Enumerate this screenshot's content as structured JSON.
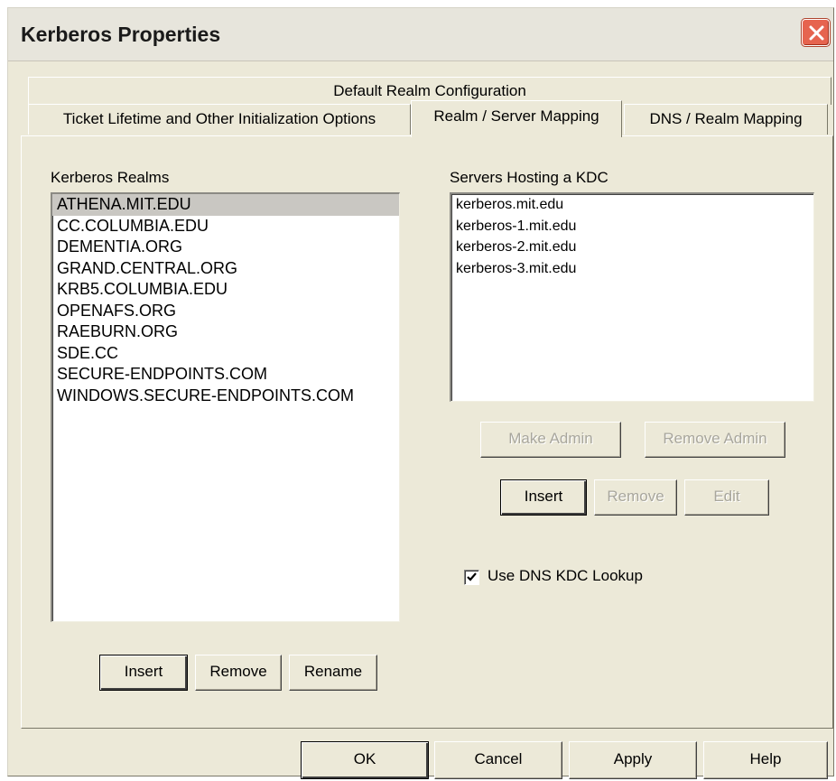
{
  "window": {
    "title": "Kerberos Properties",
    "close_icon": "close-icon"
  },
  "tabs": {
    "back_row": [
      {
        "label": "Default Realm Configuration"
      }
    ],
    "front_row": [
      {
        "label": "Ticket Lifetime and Other Initialization Options",
        "active": false
      },
      {
        "label": "Realm / Server Mapping",
        "active": true
      },
      {
        "label": "DNS / Realm Mapping",
        "active": false
      }
    ]
  },
  "realms": {
    "label": "Kerberos Realms",
    "selected": "ATHENA.MIT.EDU",
    "items": [
      "ATHENA.MIT.EDU",
      "CC.COLUMBIA.EDU",
      "DEMENTIA.ORG",
      "GRAND.CENTRAL.ORG",
      "KRB5.COLUMBIA.EDU",
      "OPENAFS.ORG",
      "RAEBURN.ORG",
      "SDE.CC",
      "SECURE-ENDPOINTS.COM",
      "WINDOWS.SECURE-ENDPOINTS.COM"
    ],
    "buttons": {
      "insert": "Insert",
      "remove": "Remove",
      "rename": "Rename"
    }
  },
  "kdc": {
    "label": "Servers Hosting a KDC",
    "items": [
      "kerberos.mit.edu",
      "kerberos-1.mit.edu",
      "kerberos-2.mit.edu",
      "kerberos-3.mit.edu"
    ],
    "buttons": {
      "make_admin": "Make Admin",
      "remove_admin": "Remove Admin",
      "insert": "Insert",
      "remove": "Remove",
      "edit": "Edit"
    },
    "dns_lookup": {
      "label": "Use DNS KDC Lookup",
      "checked": true
    }
  },
  "footer": {
    "ok": "OK",
    "cancel": "Cancel",
    "apply": "Apply",
    "help": "Help"
  }
}
